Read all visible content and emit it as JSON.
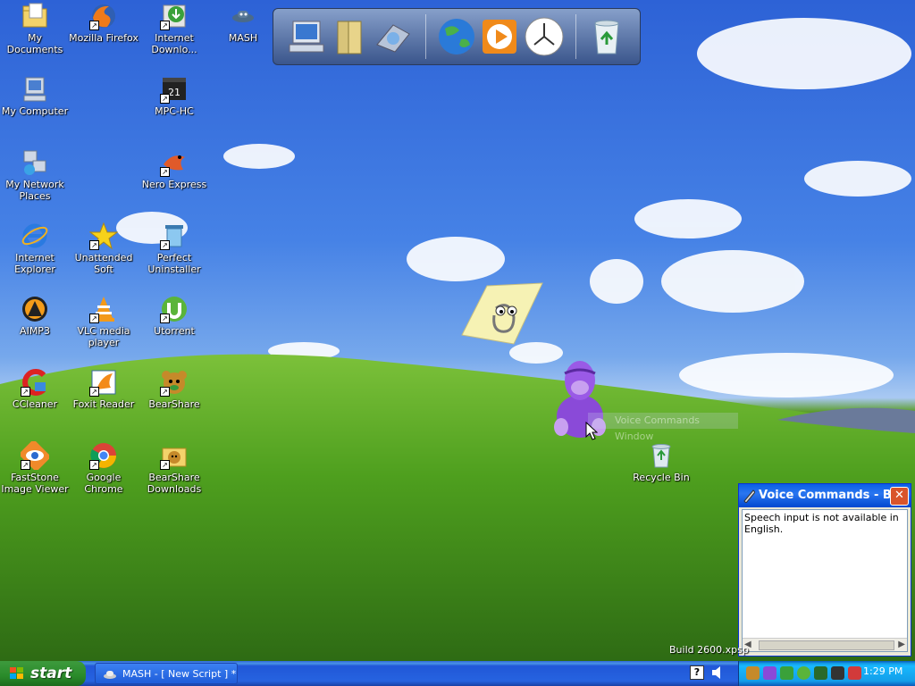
{
  "desktop": {
    "icons": [
      {
        "label": "My Documents"
      },
      {
        "label": "Mozilla Firefox"
      },
      {
        "label": "Internet Downlo..."
      },
      {
        "label": "MASH"
      },
      {
        "label": "My Computer"
      },
      {
        "label": "MPC-HC"
      },
      {
        "label": "My Network Places"
      },
      {
        "label": "Nero Express"
      },
      {
        "label": "Internet Explorer"
      },
      {
        "label": "Unattended Soft"
      },
      {
        "label": "Perfect Uninstaller"
      },
      {
        "label": "AIMP3"
      },
      {
        "label": "VLC media player"
      },
      {
        "label": "Utorrent"
      },
      {
        "label": "CCleaner"
      },
      {
        "label": "Foxit Reader"
      },
      {
        "label": "BearShare"
      },
      {
        "label": "FastStone Image Viewer"
      },
      {
        "label": "Google Chrome"
      },
      {
        "label": "BearShare Downloads"
      },
      {
        "label": "Recycle Bin"
      }
    ]
  },
  "dock": {
    "items": [
      "computer-icon",
      "documents-icon",
      "drive-icon",
      "globe-icon",
      "media-player-icon",
      "clock-icon",
      "recycle-bin-icon"
    ]
  },
  "agent": {
    "caption": "Voice Commands Window"
  },
  "voice_commands": {
    "title": "Voice Commands - B...",
    "message": "Speech input is not available in English.",
    "close": "✕"
  },
  "build": "Build 2600.xpsp",
  "taskbar": {
    "start_label": "start",
    "task_label": "MASH - [ New Script ] *",
    "help": "?",
    "clock": "1:29 PM"
  },
  "colors": {
    "taskbar": "#245edb",
    "start": "#3c9a3c",
    "tray": "#139ee9"
  }
}
